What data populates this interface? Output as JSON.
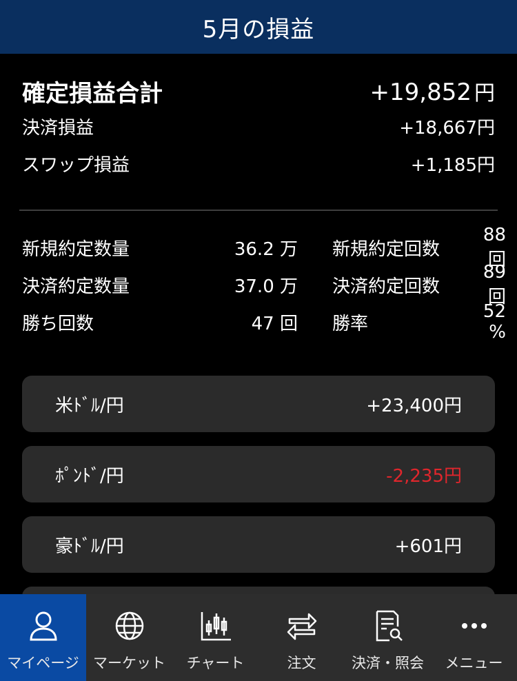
{
  "header": {
    "title": "5月の損益"
  },
  "summary": {
    "total_label": "確定損益合計",
    "total_value": "+19,852",
    "total_unit": "円",
    "settlement_label": "決済損益",
    "settlement_value": "+18,667円",
    "swap_label": "スワップ損益",
    "swap_value": "+1,185円"
  },
  "stats": {
    "rows": [
      {
        "left_label": "新規約定数量",
        "left_value": "36.2 万",
        "right_label": "新規約定回数",
        "right_value": "88 回"
      },
      {
        "left_label": "決済約定数量",
        "left_value": "37.0 万",
        "right_label": "決済約定回数",
        "right_value": "89 回"
      },
      {
        "left_label": "勝ち回数",
        "left_value": "47 回",
        "right_label": "勝率",
        "right_value": "52 %"
      }
    ]
  },
  "currencies": [
    {
      "pair": "米ﾄﾞﾙ/円",
      "value": "+23,400円"
    },
    {
      "pair": "ﾎﾟﾝﾄﾞ/円",
      "value": "-2,235円"
    },
    {
      "pair": "豪ﾄﾞﾙ/円",
      "value": "+601円"
    }
  ],
  "nav": [
    {
      "label": "マイページ",
      "icon": "person-icon"
    },
    {
      "label": "マーケット",
      "icon": "globe-icon"
    },
    {
      "label": "チャート",
      "icon": "candlestick-chart-icon"
    },
    {
      "label": "注文",
      "icon": "swap-arrows-icon"
    },
    {
      "label": "決済・照会",
      "icon": "document-search-icon"
    },
    {
      "label": "メニュー",
      "icon": "more-dots-icon"
    }
  ],
  "colors": {
    "header_bg": "#0a2f5f",
    "card_bg": "#2b2b2b",
    "negative": "#e0262c",
    "nav_active": "#0a4aa3",
    "nav_bg": "#2d2d2d"
  }
}
